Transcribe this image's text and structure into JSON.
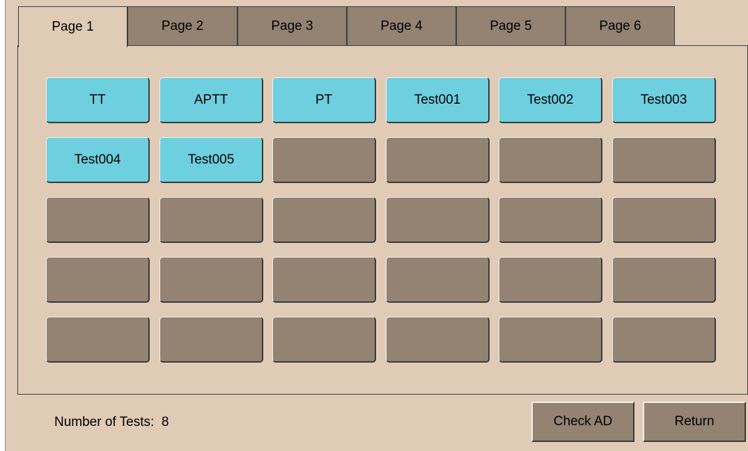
{
  "tabs": [
    {
      "label": "Page 1",
      "active": true
    },
    {
      "label": "Page 2",
      "active": false
    },
    {
      "label": "Page 3",
      "active": false
    },
    {
      "label": "Page 4",
      "active": false
    },
    {
      "label": "Page 5",
      "active": false
    },
    {
      "label": "Page 6",
      "active": false
    }
  ],
  "tests": [
    [
      "TT",
      "APTT",
      "PT",
      "Test001",
      "Test002",
      "Test003"
    ],
    [
      "Test004",
      "Test005",
      "",
      "",
      "",
      ""
    ],
    [
      "",
      "",
      "",
      "",
      "",
      ""
    ],
    [
      "",
      "",
      "",
      "",
      "",
      ""
    ],
    [
      "",
      "",
      "",
      "",
      "",
      ""
    ]
  ],
  "footer": {
    "count_label": "Number of Tests:",
    "count_value": "8",
    "check_ad_label": "Check AD",
    "return_label": "Return"
  },
  "colors": {
    "background": "#dfcbb6",
    "empty_slot": "#948272",
    "test_slot": "#6ecfdf"
  }
}
